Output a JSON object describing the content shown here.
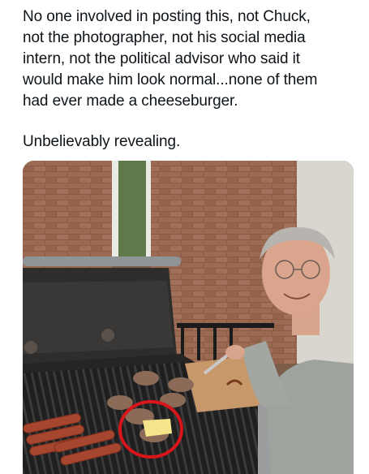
{
  "post": {
    "lines": [
      "No one involved in posting this, not Chuck,",
      "not the photographer, not his social media",
      "intern, not the political advisor who said it",
      "would make him look normal...none of them",
      "had ever made a cheeseburger."
    ],
    "closing": "Unbelievably revealing."
  },
  "media": {
    "annotation_color": "#d8151b"
  }
}
